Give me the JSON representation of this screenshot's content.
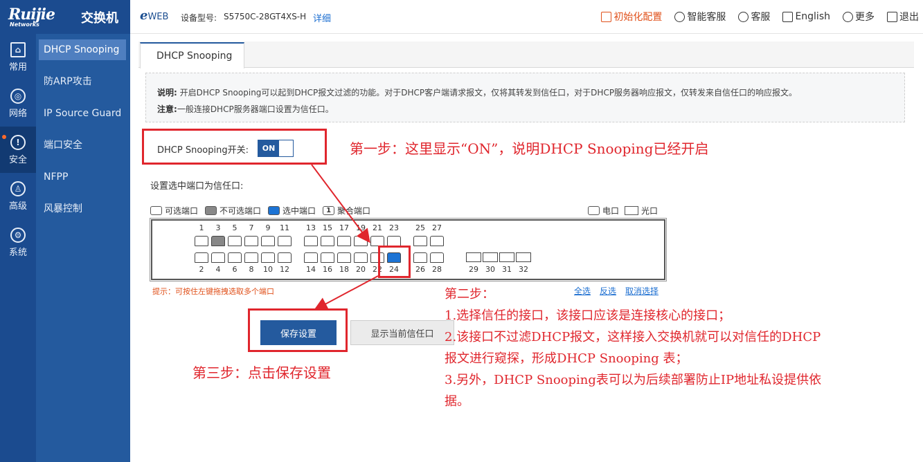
{
  "header": {
    "logo": "Ruijie",
    "logo_sub": "Networks",
    "product": "交换机",
    "eweb_e": "e",
    "eweb_web": "WEB",
    "model_label": "设备型号:",
    "model_value": "S5750C-28GT4XS-H",
    "detail_link": "详细",
    "links": [
      {
        "label": "初始化配置",
        "icon": "reset-icon"
      },
      {
        "label": "智能客服",
        "icon": "smart-service-icon"
      },
      {
        "label": "客服",
        "icon": "support-icon"
      },
      {
        "label": "English",
        "icon": "language-icon"
      },
      {
        "label": "更多",
        "icon": "more-icon"
      },
      {
        "label": "退出",
        "icon": "logout-icon"
      }
    ]
  },
  "nav": [
    {
      "label": "常用",
      "icon": "home-icon"
    },
    {
      "label": "网络",
      "icon": "network-icon"
    },
    {
      "label": "安全",
      "icon": "shield-icon",
      "active": true
    },
    {
      "label": "高级",
      "icon": "user-gear-icon"
    },
    {
      "label": "系统",
      "icon": "gear-icon"
    }
  ],
  "submenu": [
    "DHCP Snooping",
    "防ARP攻击",
    "IP Source Guard",
    "端口安全",
    "NFPP",
    "风暴控制"
  ],
  "tab": "DHCP Snooping",
  "note": {
    "line1_label": "说明:",
    "line1_text": "开启DHCP Snooping可以起到DHCP报文过滤的功能。对于DHCP客户端请求报文，仅将其转发到信任口，对于DHCP服务器响应报文，仅转发来自信任口的响应报文。",
    "line2_label": "注意:",
    "line2_text": "一般连接DHCP服务器端口设置为信任口。"
  },
  "switch": {
    "label": "DHCP Snooping开关:",
    "state": "ON"
  },
  "trust_title": "设置选中端口为信任口:",
  "legend": {
    "available": "可选端口",
    "unavailable": "不可选端口",
    "selected": "选中端口",
    "aggregate_num": "1",
    "aggregate": "聚合端口",
    "electric": "电口",
    "optical": "光口"
  },
  "ports": {
    "top": [
      "1",
      "3",
      "5",
      "7",
      "9",
      "11",
      "13",
      "15",
      "17",
      "19",
      "21",
      "23",
      "25",
      "27"
    ],
    "bottom": [
      "2",
      "4",
      "6",
      "8",
      "10",
      "12",
      "14",
      "16",
      "18",
      "20",
      "22",
      "24",
      "26",
      "28"
    ],
    "optical": [
      "29",
      "30",
      "31",
      "32"
    ],
    "disabled": [
      "3"
    ],
    "selected": [
      "24"
    ]
  },
  "hint": "提示：可按住左键拖拽选取多个端口",
  "select_links": [
    "全选",
    "反选",
    "取消选择"
  ],
  "buttons": {
    "save": "保存设置",
    "show": "显示当前信任口"
  },
  "annotations": {
    "step1": "第一步：这里显示“ON”，说明DHCP Snooping已经开启",
    "step2_title": "第二步：",
    "step2_l1": "1.选择信任的接口，该接口应该是连接核心的接口；",
    "step2_l2": "2.该接口不过滤DHCP报文，这样接入交换机就可以对信任的DHCP",
    "step2_l3": "报文进行窥探，形成DHCP Snooping 表；",
    "step2_l4": "3.另外，DHCP Snooping表可以为后续部署防止IP地址私设提供依",
    "step2_l5": "据。",
    "step3": "第三步：点击保存设置"
  },
  "colors": {
    "brand": "#1b4b8f",
    "annotation": "#e0262d",
    "selected_port": "#1c73d4",
    "disabled_port": "#888888"
  }
}
